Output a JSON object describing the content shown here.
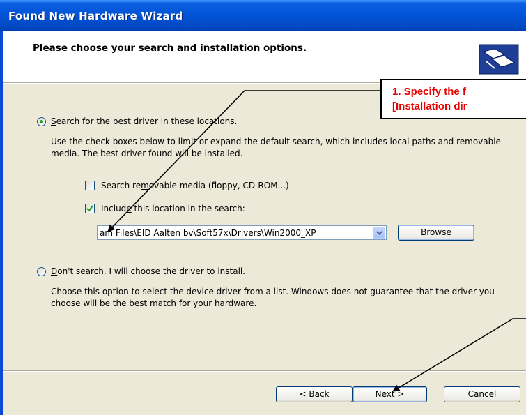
{
  "window": {
    "title": "Found New Hardware Wizard"
  },
  "header": {
    "heading": "Please choose your search and installation options.",
    "icon": "hardware-wizard-icon"
  },
  "option_search": {
    "label_mnemonic": "S",
    "label_rest": "earch for the best driver in these locations.",
    "selected": true,
    "description": "Use the check boxes below to limit or expand the default search, which includes local paths and removable media. The best driver found will be installed.",
    "removable_media": {
      "label_pre": "Search re",
      "label_mnemonic": "m",
      "label_post": "ovable media (floppy, CD-ROM...)",
      "checked": false
    },
    "include_location": {
      "label_pre": "Includ",
      "label_mnemonic": "e",
      "label_post": " this location in the search:",
      "checked": true
    },
    "location_value": "am Files\\EID Aalten bv\\Soft57x\\Drivers\\Win2000_XP",
    "browse_mnemonic": "r",
    "browse_pre": "B",
    "browse_post": "owse"
  },
  "option_dont_search": {
    "label_mnemonic": "D",
    "label_rest": "on't search. I will choose the driver to install.",
    "selected": false,
    "description": "Choose this option to select the device driver from a list.  Windows does not guarantee that the driver you choose will be the best match for your hardware."
  },
  "footer": {
    "back_pre": "< ",
    "back_mnemonic": "B",
    "back_post": "ack",
    "next_mnemonic": "N",
    "next_post": "ext >",
    "cancel": "Cancel"
  },
  "callout": {
    "line1": "1. Specify the f",
    "line2": "[Installation dir",
    "color": "#e80000"
  },
  "colors": {
    "titlebar": "#0353d6",
    "dialog_bg": "#ece9d8",
    "radio_dot": "#21a121"
  }
}
